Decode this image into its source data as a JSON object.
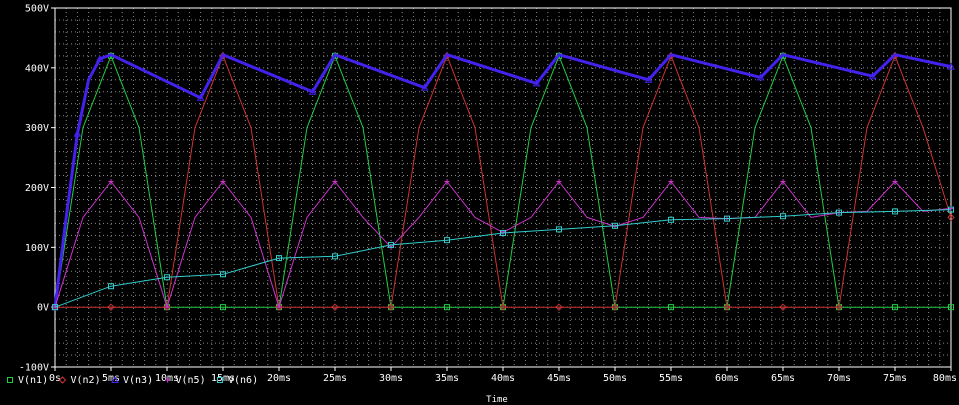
{
  "chart_data": {
    "type": "line",
    "xlabel": "Time",
    "ylabel": "",
    "xlim": [
      0,
      80
    ],
    "ylim": [
      -100,
      500
    ],
    "x_ticks": [
      0,
      5,
      10,
      15,
      20,
      25,
      30,
      35,
      40,
      45,
      50,
      55,
      60,
      65,
      70,
      75,
      80
    ],
    "x_tick_labels": [
      "0s",
      "5ms",
      "10ms",
      "15ms",
      "20ms",
      "25ms",
      "30ms",
      "35ms",
      "40ms",
      "45ms",
      "50ms",
      "55ms",
      "60ms",
      "65ms",
      "70ms",
      "75ms",
      "80ms"
    ],
    "y_ticks": [
      -100,
      0,
      100,
      200,
      300,
      400,
      500
    ],
    "y_tick_labels": [
      "-100V",
      "0V",
      "100V",
      "200V",
      "300V",
      "400V",
      "500V"
    ],
    "grid": true,
    "legend_position": "bottom-left",
    "series": [
      {
        "name": "V(n1)",
        "color": "#22cc44",
        "marker": "square",
        "x": [
          0,
          2.5,
          5,
          7.5,
          10,
          12.5,
          15,
          17.5,
          20,
          22.5,
          25,
          27.5,
          30,
          32.5,
          35,
          37.5,
          40,
          42.5,
          45,
          47.5,
          50,
          52.5,
          55,
          57.5,
          60,
          62.5,
          65,
          67.5,
          70,
          72.5,
          75,
          77.5,
          80
        ],
        "y": [
          0,
          300,
          420,
          300,
          0,
          0,
          0,
          0,
          0,
          300,
          420,
          300,
          0,
          0,
          0,
          0,
          0,
          300,
          420,
          300,
          0,
          0,
          0,
          0,
          0,
          300,
          420,
          300,
          0,
          0,
          0,
          0,
          0
        ]
      },
      {
        "name": "V(n2)",
        "color": "#cc3333",
        "marker": "diamond",
        "x": [
          0,
          2.5,
          5,
          7.5,
          10,
          12.5,
          15,
          17.5,
          20,
          22.5,
          25,
          27.5,
          30,
          32.5,
          35,
          37.5,
          40,
          42.5,
          45,
          47.5,
          50,
          52.5,
          55,
          57.5,
          60,
          62.5,
          65,
          67.5,
          70,
          72.5,
          75,
          77.5,
          80
        ],
        "y": [
          0,
          0,
          0,
          0,
          0,
          300,
          420,
          300,
          0,
          0,
          0,
          0,
          0,
          300,
          420,
          300,
          0,
          0,
          0,
          0,
          0,
          300,
          420,
          300,
          0,
          0,
          0,
          0,
          0,
          300,
          420,
          300,
          150
        ]
      },
      {
        "name": "V(n3)",
        "color": "#4422ee",
        "marker": "triangle",
        "x": [
          0,
          1,
          2,
          3,
          4,
          5,
          13,
          15,
          23,
          25,
          33,
          35,
          43,
          45,
          53,
          55,
          63,
          65,
          73,
          75,
          80
        ],
        "y": [
          0,
          150,
          290,
          380,
          415,
          422,
          350,
          422,
          360,
          422,
          367,
          422,
          374,
          422,
          380,
          422,
          384,
          422,
          386,
          422,
          402
        ]
      },
      {
        "name": "V(n5)",
        "color": "#cc33cc",
        "marker": "plus",
        "x": [
          0,
          2.5,
          5,
          7.5,
          10,
          12.5,
          15,
          17.5,
          20,
          22.5,
          25,
          27.5,
          30,
          32.5,
          35,
          37.5,
          40,
          42.5,
          45,
          47.5,
          50,
          52.5,
          55,
          57.5,
          60,
          62.5,
          65,
          67.5,
          70,
          72.5,
          75,
          77.5,
          80
        ],
        "y": [
          0,
          150,
          210,
          150,
          0,
          150,
          210,
          150,
          0,
          150,
          210,
          150,
          100,
          150,
          210,
          150,
          125,
          150,
          210,
          150,
          135,
          150,
          210,
          150,
          148,
          150,
          210,
          150,
          158,
          160,
          210,
          160,
          165
        ]
      },
      {
        "name": "V(n6)",
        "color": "#33cccc",
        "marker": "square",
        "x": [
          0,
          5,
          10,
          15,
          20,
          25,
          30,
          35,
          40,
          45,
          50,
          55,
          60,
          65,
          70,
          75,
          80
        ],
        "y": [
          0,
          35,
          50,
          55,
          82,
          85,
          104,
          112,
          124,
          130,
          136,
          146,
          148,
          152,
          158,
          160,
          163
        ]
      }
    ]
  }
}
